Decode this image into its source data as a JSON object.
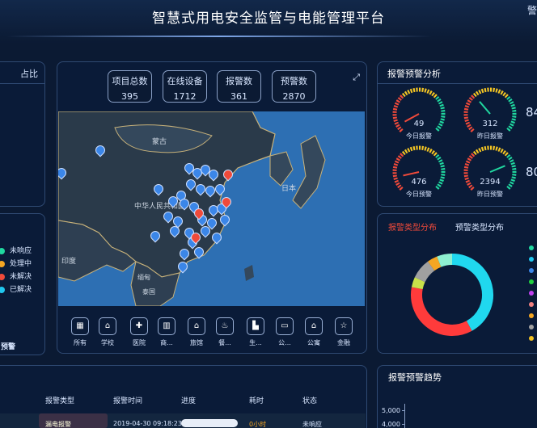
{
  "header": {
    "title": "智慧式用电安全监管与电能管理平台",
    "corner_text": "警"
  },
  "left_top": {
    "label": "占比"
  },
  "stats": [
    {
      "label": "项目总数",
      "value": "395"
    },
    {
      "label": "在线设备",
      "value": "1712"
    },
    {
      "label": "报警数",
      "value": "361"
    },
    {
      "label": "预警数",
      "value": "2870"
    }
  ],
  "map": {
    "labels": {
      "mongolia": "蒙古",
      "china": "中华人民共和国",
      "japan": "日本",
      "india": "印度",
      "myanmar": "缅甸",
      "thailand": "泰国"
    }
  },
  "categories": [
    "所有",
    "学校",
    "医院",
    "商...",
    "旅馆",
    "餐...",
    "生...",
    "公...",
    "公寓",
    "金融"
  ],
  "status_legend": [
    {
      "label": "未响应",
      "color": "#20d8a0"
    },
    {
      "label": "处理中",
      "color": "#f5a623"
    },
    {
      "label": "未解决",
      "color": "#f04a3a"
    },
    {
      "label": "已解决",
      "color": "#20c8f0"
    }
  ],
  "left_bottom_label": "预警",
  "alarm_analysis": {
    "title": "报警预警分析",
    "gauges": [
      {
        "value": "49",
        "label": "今日报警",
        "fraction": 0.06
      },
      {
        "value": "312",
        "label": "昨日报警",
        "fraction": 0.35
      },
      {
        "value": "476",
        "label": "今日预警",
        "fraction": 0.12
      },
      {
        "value": "2394",
        "label": "昨日预警",
        "fraction": 0.75
      }
    ],
    "side_values": [
      "84",
      "80"
    ]
  },
  "distribution": {
    "tab_active": "报警类型分布",
    "tab_inactive": "预警类型分布",
    "slices": [
      {
        "color": "#20d8ef",
        "fraction": 0.42
      },
      {
        "color": "#ff3b3b",
        "fraction": 0.36
      },
      {
        "color": "#c9e14a",
        "fraction": 0.04
      },
      {
        "color": "#a0a0a0",
        "fraction": 0.08
      },
      {
        "color": "#f5a623",
        "fraction": 0.04
      },
      {
        "color": "#8ef0d0",
        "fraction": 0.06
      }
    ]
  },
  "trend": {
    "title": "报警预警趋势",
    "ticks": [
      "5,000",
      "4,000"
    ]
  },
  "table": {
    "headers": [
      "报警类型",
      "报警时间",
      "进度",
      "耗时",
      "状态"
    ],
    "row": {
      "type": "漏电报警",
      "time": "2019-04-30 09:18:23",
      "duration": "0小时",
      "status": "未响应"
    }
  }
}
